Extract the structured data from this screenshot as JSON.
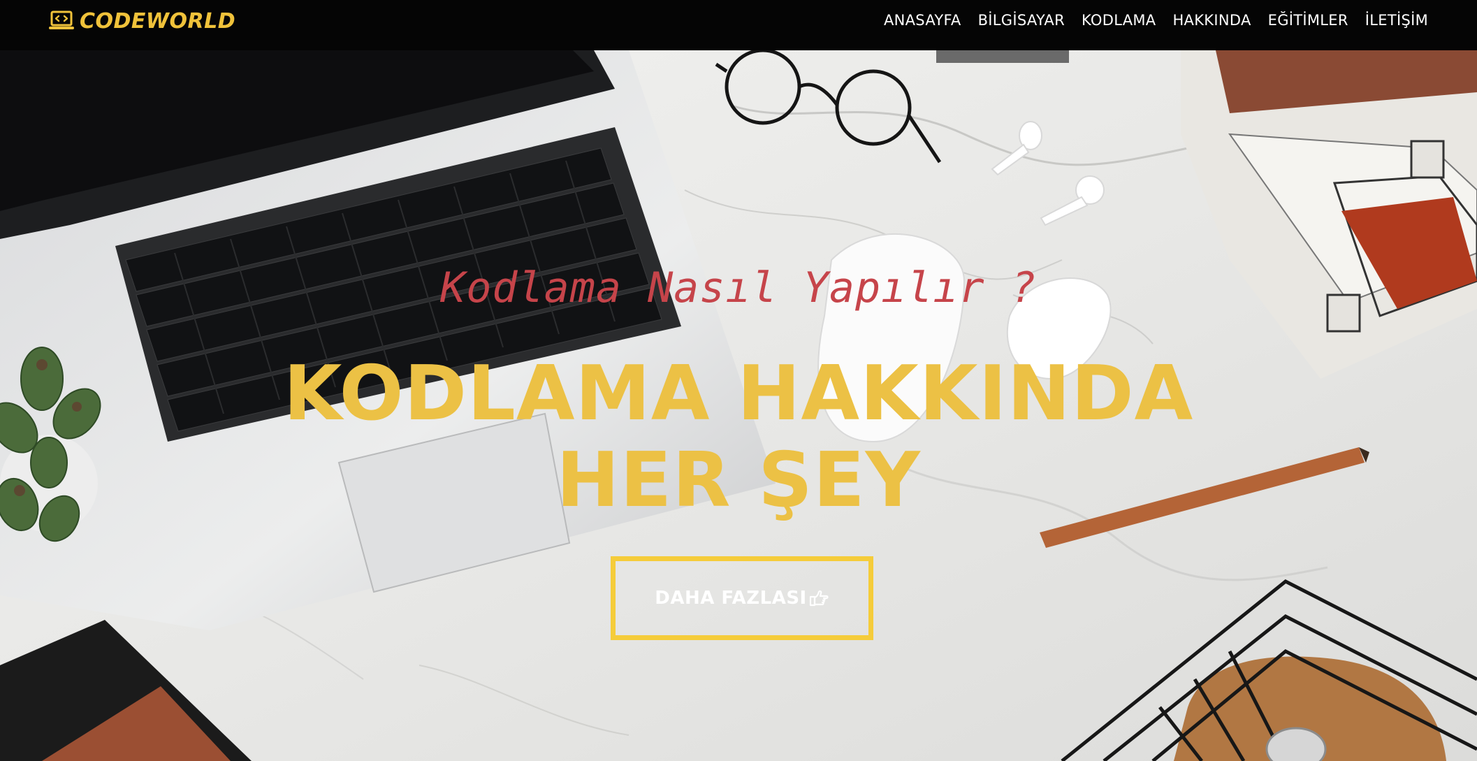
{
  "navbar": {
    "brand": "CODEWORLD",
    "links": [
      "ANASAYFA",
      "BİLGİSAYAR",
      "KODLAMA",
      "HAKKINDA",
      "EĞİTİMLER",
      "İLETİŞİM"
    ]
  },
  "hero": {
    "subtitle": "Kodlama Nasıl Yapılır ?",
    "headline": "KODLAMA HAKKINDA HER ŞEY",
    "cta_label": "DAHA FAZLASI"
  },
  "icons": {
    "brand": "laptop-code-icon",
    "cta": "hand-pointing-right-icon"
  },
  "colors": {
    "accent": "#f0c23a",
    "subtitle": "#c6444a",
    "navbar_bg": "#050505"
  }
}
